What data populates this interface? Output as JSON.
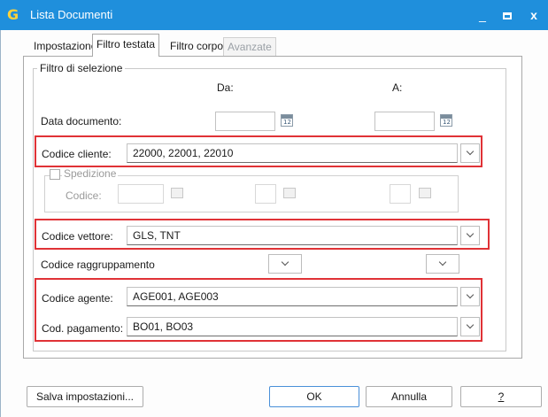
{
  "window": {
    "icon_glyph": "G",
    "title": "Lista Documenti",
    "minimize": "_",
    "close": "x"
  },
  "tabs": [
    {
      "label": "Impostazione",
      "active": false,
      "enabled": true
    },
    {
      "label": "Filtro testata",
      "active": true,
      "enabled": true
    },
    {
      "label": "Filtro corpo",
      "active": false,
      "enabled": true
    },
    {
      "label": "Avanzate",
      "active": false,
      "enabled": false
    }
  ],
  "filter": {
    "group_title": "Filtro di selezione",
    "col_from": "Da:",
    "col_to": "A:",
    "data_documento": {
      "label": "Data documento:",
      "from": "",
      "to": "",
      "icon": "calendar-icon",
      "icon_text": "12"
    },
    "codice_cliente": {
      "label": "Codice cliente:",
      "value": "22000, 22001, 22010"
    },
    "spedizione": {
      "label": "Spedizione",
      "checked": false,
      "codice_label": "Codice:"
    },
    "codice_vettore": {
      "label": "Codice vettore:",
      "value": "GLS, TNT"
    },
    "codice_raggruppamento": {
      "label": "Codice raggruppamento",
      "from": "",
      "to": ""
    },
    "codice_agente": {
      "label": "Codice agente:",
      "value": "AGE001, AGE003"
    },
    "cod_pagamento": {
      "label": "Cod. pagamento:",
      "value": "BO01, BO03"
    }
  },
  "highlight_color": "#e03236",
  "buttons": {
    "salva": "Salva impostazioni...",
    "ok": "OK",
    "annulla": "Annulla",
    "help": "?"
  }
}
